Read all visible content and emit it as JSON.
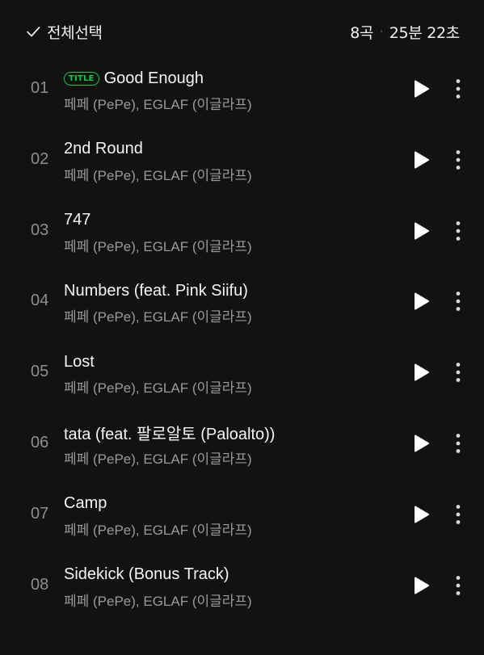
{
  "header": {
    "select_all_label": "전체선택",
    "track_count": "8곡",
    "separator": "·",
    "total_duration": "25분 22초"
  },
  "title_badge": "TITLE",
  "tracks": [
    {
      "number": "01",
      "title": "Good Enough",
      "artist": "페페 (PePe), EGLAF (이글라프)",
      "is_title": true
    },
    {
      "number": "02",
      "title": "2nd Round",
      "artist": "페페 (PePe), EGLAF (이글라프)",
      "is_title": false
    },
    {
      "number": "03",
      "title": "747",
      "artist": "페페 (PePe), EGLAF (이글라프)",
      "is_title": false
    },
    {
      "number": "04",
      "title": "Numbers (feat. Pink Siifu)",
      "artist": "페페 (PePe), EGLAF (이글라프)",
      "is_title": false
    },
    {
      "number": "05",
      "title": "Lost",
      "artist": "페페 (PePe), EGLAF (이글라프)",
      "is_title": false
    },
    {
      "number": "06",
      "title": "tata (feat. 팔로알토 (Paloalto))",
      "artist": "페페 (PePe), EGLAF (이글라프)",
      "is_title": false
    },
    {
      "number": "07",
      "title": "Camp",
      "artist": "페페 (PePe), EGLAF (이글라프)",
      "is_title": false
    },
    {
      "number": "08",
      "title": "Sidekick (Bonus Track)",
      "artist": "페페 (PePe), EGLAF (이글라프)",
      "is_title": false
    }
  ],
  "icons": {
    "select_all": "checkmark-icon",
    "play": "play-icon",
    "more": "more-vertical-icon"
  },
  "colors": {
    "background": "#121212",
    "accent": "#00cd3c",
    "primary_text": "#f5f5f5",
    "secondary_text": "#9a9a9a"
  }
}
